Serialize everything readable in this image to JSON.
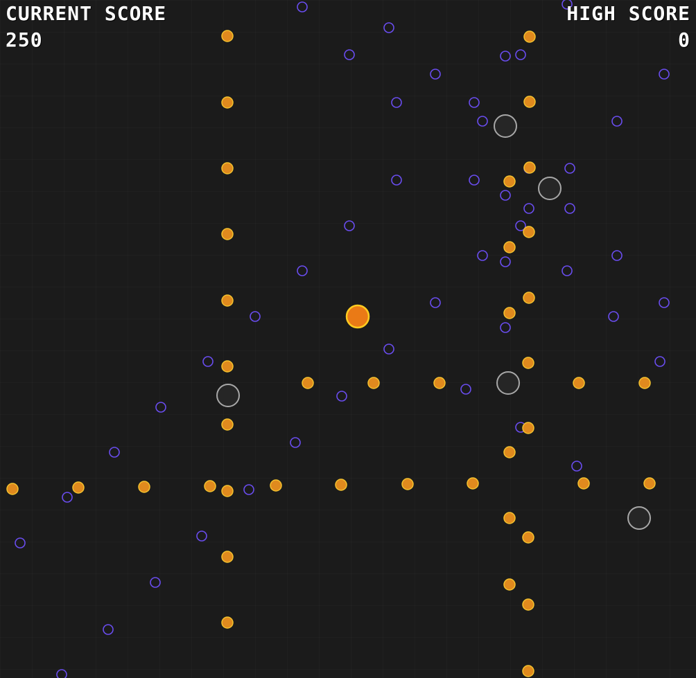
{
  "hud": {
    "current_score_label": "CURRENT SCORE",
    "current_score": "250",
    "high_score_label": "HIGH SCORE",
    "high_score": "0"
  },
  "colors": {
    "background": "#1b1b1b",
    "coin_fill": "#e08a1e",
    "coin_rim": "#f4c22e",
    "ring_stroke": "#6a4df0",
    "rock_fill": "#262626",
    "rock_stroke": "#a8a8a8",
    "player_fill": "#ea7a16",
    "player_rim": "#ffcc20"
  },
  "icons": {
    "coin": "orange-coin-icon",
    "ring": "purple-ring-icon",
    "rock": "grey-boulder-icon",
    "player": "player-orb-icon"
  }
}
